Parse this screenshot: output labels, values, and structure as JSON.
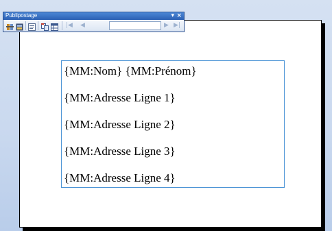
{
  "toolbar": {
    "title": "Publipostage",
    "dropdown_glyph": "▾",
    "close_glyph": "×",
    "buttons": [
      {
        "name": "insert-fields-icon"
      },
      {
        "name": "preview-results-icon"
      },
      {
        "name": "data-source-icon"
      },
      {
        "name": "merge-to-document-icon"
      },
      {
        "name": "merge-grid-icon"
      }
    ],
    "record_value": "",
    "nav": {
      "first": "|◀",
      "prev": "◀",
      "next": "▶",
      "last": "▶|"
    }
  },
  "document": {
    "lines": [
      "{MM:Nom} {MM:Prénom}",
      "{MM:Adresse Ligne 1}",
      "{MM:Adresse Ligne 2}",
      "{MM:Adresse Ligne 3}",
      "{MM:Adresse Ligne 4}"
    ]
  },
  "colors": {
    "frame_border": "#4d95d6",
    "titlebar": "#2b5fb3",
    "background": "#cad9ef"
  }
}
